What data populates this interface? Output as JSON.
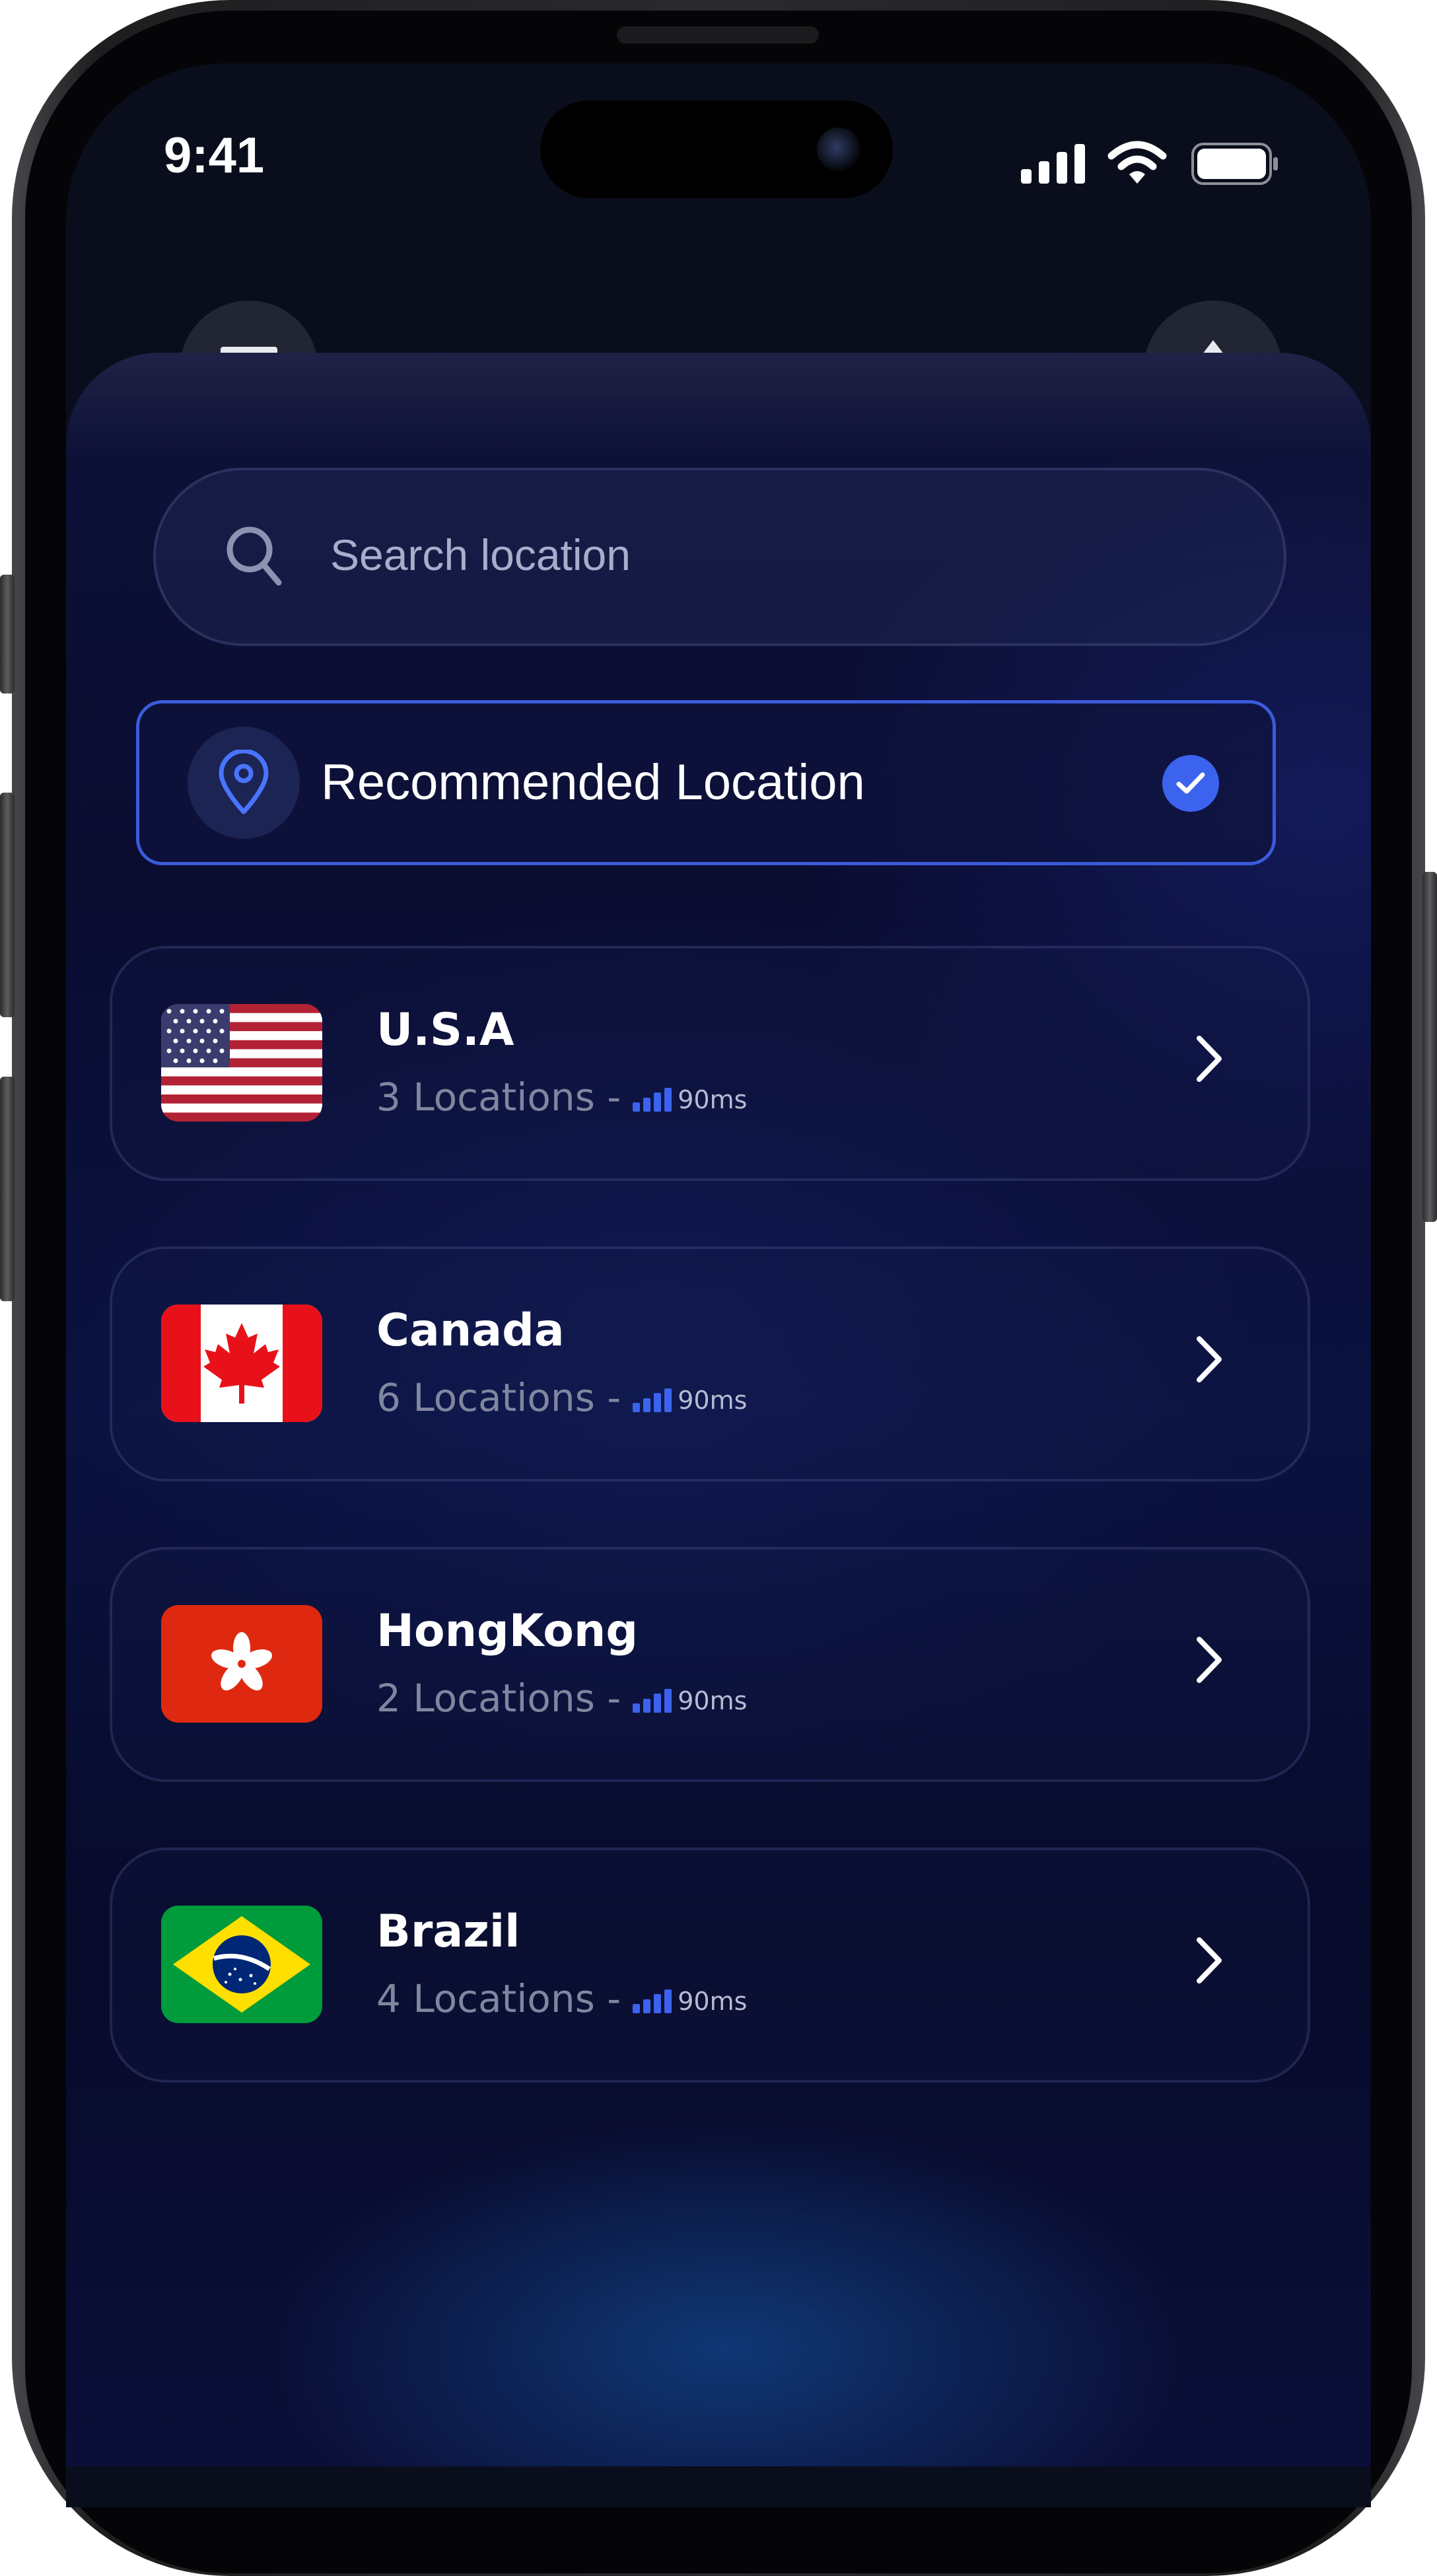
{
  "status_bar": {
    "time": "9:41"
  },
  "search": {
    "placeholder": "Search location"
  },
  "recommended": {
    "label": "Recommended Location",
    "selected": true
  },
  "locations": [
    {
      "country": "U.S.A",
      "count_text": "3 Locations -",
      "ping": "90ms",
      "flag_icon": "us-flag-icon"
    },
    {
      "country": "Canada",
      "count_text": "6 Locations -",
      "ping": "90ms",
      "flag_icon": "canada-flag-icon"
    },
    {
      "country": "HongKong",
      "count_text": "2 Locations -",
      "ping": "90ms",
      "flag_icon": "hongkong-flag-icon"
    },
    {
      "country": "Brazil",
      "count_text": "4 Locations -",
      "ping": "90ms",
      "flag_icon": "brazil-flag-icon"
    }
  ],
  "colors": {
    "accent": "#3C63EE",
    "background": "#0A0C30",
    "muted_text": "#80869F"
  }
}
